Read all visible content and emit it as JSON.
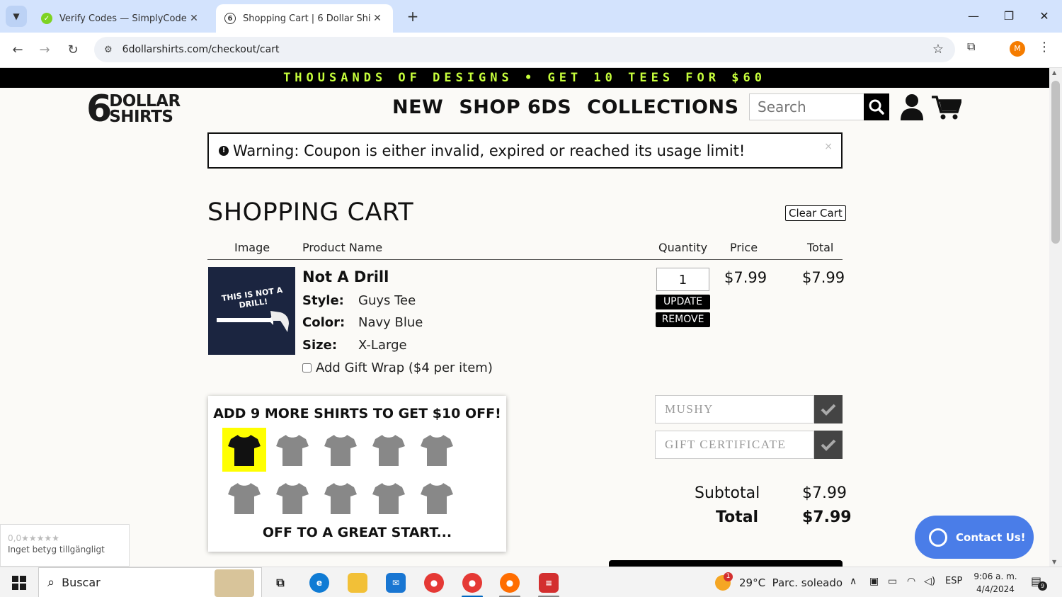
{
  "browser": {
    "tabs": [
      {
        "title": "Verify Codes — SimplyCodes",
        "active": false
      },
      {
        "title": "Shopping Cart | 6 Dollar Shirts",
        "active": true
      }
    ],
    "url": "6dollarshirts.com/checkout/cart",
    "profile_initial": "M"
  },
  "site": {
    "promo_banner": "THOUSANDS OF DESIGNS • GET 10 TEES FOR $60",
    "logo": {
      "numeral": "6",
      "line1": "DOLLAR",
      "line2": "SHIRTS"
    },
    "nav": [
      "NEW",
      "SHOP 6DS",
      "COLLECTIONS"
    ],
    "search_placeholder": "Search"
  },
  "warning": {
    "icon": "exclamation-circle-icon",
    "text": "Warning: Coupon is either invalid, expired or reached its usage limit!",
    "dismiss": "×"
  },
  "cart": {
    "title": "SHOPPING CART",
    "clear_label": "Clear Cart",
    "columns": {
      "image": "Image",
      "product": "Product Name",
      "quantity": "Quantity",
      "price": "Price",
      "total": "Total"
    },
    "item": {
      "image_text": "THIS IS NOT A DRILL!",
      "name": "Not A Drill",
      "attributes": [
        {
          "label": "Style:",
          "value": "Guys Tee"
        },
        {
          "label": "Color:",
          "value": "Navy Blue"
        },
        {
          "label": "Size:",
          "value": "X-Large"
        }
      ],
      "quantity": "1",
      "update_label": "UPDATE",
      "remove_label": "REMOVE",
      "price": "$7.99",
      "total": "$7.99"
    },
    "gift_wrap_label": "Add Gift Wrap ($4 per item)",
    "gift_wrap_checked": false
  },
  "promo_box": {
    "title": "ADD 9 MORE SHIRTS TO GET $10 OFF!",
    "shirts_filled": 1,
    "shirts_total": 10,
    "footer": "OFF TO A GREAT START..."
  },
  "codes": {
    "coupon_value": "MUSHY",
    "gift_placeholder": "GIFT CERTIFICATE"
  },
  "summary": {
    "subtotal_label": "Subtotal",
    "subtotal": "$7.99",
    "total_label": "Total",
    "total": "$7.99"
  },
  "review_widget": {
    "rating": "0,0",
    "stars": "★★★★★",
    "text": "Inget betyg tillgängligt"
  },
  "contact_label": "Contact Us!",
  "taskbar": {
    "search_label": "Buscar",
    "weather": "29°C  Parc. soleado",
    "weather_badge": "1",
    "language": "ESP",
    "time": "9:06 a. m.",
    "date": "4/4/2024",
    "notifications": "9"
  },
  "colors": {
    "promo_text": "#c7ff3c",
    "contact_button": "#4a7de8",
    "progress_filled": "#ffff00"
  }
}
